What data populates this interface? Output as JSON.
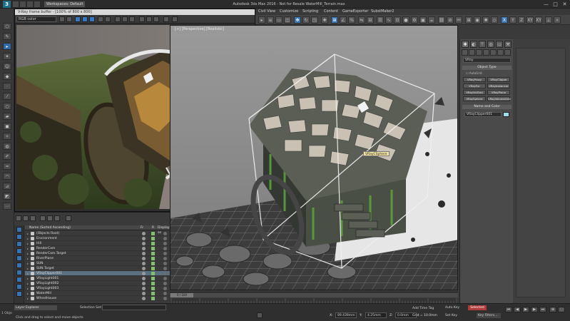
{
  "titlebar": {
    "logo": "3",
    "workspace": "Workspaces: Default",
    "title": "Autodesk 3ds Max 2016 - Not for Resale   WaterMill_Terrain.max",
    "min": "—",
    "max": "□",
    "close": "✕"
  },
  "menubar": {
    "items": [
      "Civil View",
      "Customize",
      "Scripting",
      "Content",
      "GameExporter",
      "SubstMaker2"
    ]
  },
  "toolbar": {
    "axis_x": "X",
    "axis_y": "Y",
    "axis_z": "Z",
    "axis_xy": "XY",
    "axis_xy2": "XY"
  },
  "framebuffer": {
    "title": "V-Ray frame buffer - [100% of 800 x 800]",
    "channel": "RGB color"
  },
  "viewport": {
    "label": "[+] [Perspective] [Realistic]",
    "tooltip": "VRayCSphere"
  },
  "command_panel": {
    "category": "VRay",
    "object_type_header": "Object Type",
    "autogrid": "AutoGrid",
    "buttons": [
      "VRayProxy",
      "VRayClipper",
      "VRayFur",
      "VRayInstancer",
      "VRayVolGrid",
      "VRayPlane",
      "VRaySphere",
      "VRayVolumeGrid"
    ],
    "name_color_header": "Name and Color",
    "object_name": "VRayClipper001"
  },
  "scene_explorer": {
    "col_name": "Name (Sorted Ascending)",
    "col_frozen": "Fr",
    "col_render": "R",
    "col_display": "Display as",
    "rows": [
      {
        "name": "(Objects Root)",
        "selected": false
      },
      {
        "name": "Environment",
        "selected": false
      },
      {
        "name": "Hill",
        "selected": false
      },
      {
        "name": "RenderCam",
        "selected": false
      },
      {
        "name": "RenderCam.Target",
        "selected": false
      },
      {
        "name": "RiverPlane",
        "selected": false
      },
      {
        "name": "SUN",
        "selected": false
      },
      {
        "name": "SUN.Target",
        "selected": false
      },
      {
        "name": "VRayClipper001",
        "selected": true
      },
      {
        "name": "VRayLight001",
        "selected": false
      },
      {
        "name": "VRayLight002",
        "selected": false
      },
      {
        "name": "VRayLight003",
        "selected": false
      },
      {
        "name": "WaterMill",
        "selected": false
      },
      {
        "name": "WheelHouse",
        "selected": false
      }
    ]
  },
  "statusbar": {
    "layer_explorer": "Layer Explorer",
    "selection_set_label": "Selection Set:",
    "selection_count": "1 Obje",
    "message": "Click and drag to select and move objects",
    "x_label": "X:",
    "x_val": "89.439mm",
    "y_label": "Y:",
    "y_val": "4.25mm",
    "z_label": "Z:",
    "z_val": "0.0mm",
    "grid": "Grid = 10.0mm",
    "autokey": "Auto Key",
    "autokey_value": "Selected",
    "setkey": "Set Key",
    "keyfilters": "Key Filters..."
  },
  "timeline": {
    "thumb": "0 / 100",
    "add_time_tag": "Add Time Tag"
  },
  "playback": {
    "first": "⏮",
    "prev": "◀",
    "play": "▶",
    "next": "▶",
    "last": "⏭"
  },
  "colors": {
    "accent": "#3b78b8",
    "selected_row": "#5a6f7f",
    "autokey": "#b03a3a"
  }
}
